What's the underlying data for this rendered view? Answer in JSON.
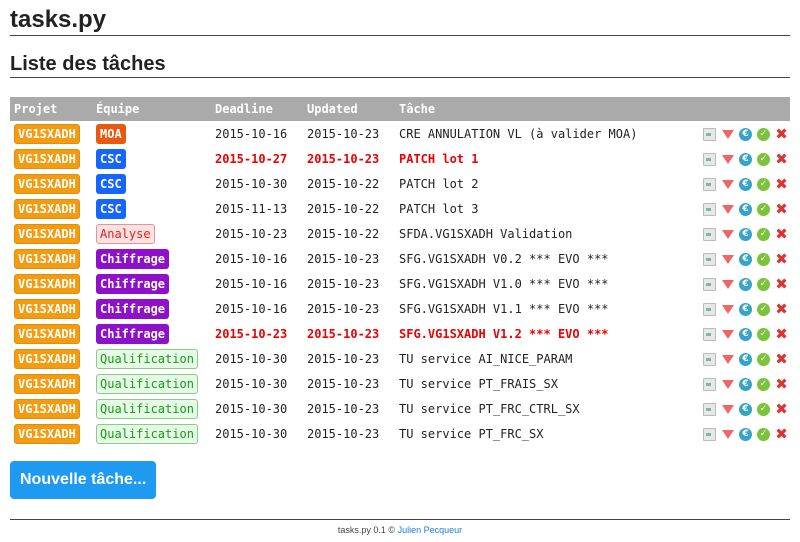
{
  "app_title": "tasks.py",
  "section_title": "Liste des tâches",
  "columns": [
    "Projet",
    "Équipe",
    "Deadline",
    "Updated",
    "Tâche"
  ],
  "rows": [
    {
      "projet": "VG1SXADH",
      "equipe": "MOA",
      "equipe_type": "moa",
      "deadline": "2015-10-16",
      "updated": "2015-10-23",
      "tache": "CRE ANNULATION VL (à valider MOA)",
      "late": false
    },
    {
      "projet": "VG1SXADH",
      "equipe": "CSC",
      "equipe_type": "csc",
      "deadline": "2015-10-27",
      "updated": "2015-10-23",
      "tache": "PATCH lot 1",
      "late": true
    },
    {
      "projet": "VG1SXADH",
      "equipe": "CSC",
      "equipe_type": "csc",
      "deadline": "2015-10-30",
      "updated": "2015-10-22",
      "tache": "PATCH lot 2",
      "late": false
    },
    {
      "projet": "VG1SXADH",
      "equipe": "CSC",
      "equipe_type": "csc",
      "deadline": "2015-11-13",
      "updated": "2015-10-22",
      "tache": "PATCH lot 3",
      "late": false
    },
    {
      "projet": "VG1SXADH",
      "equipe": "Analyse",
      "equipe_type": "ana",
      "deadline": "2015-10-23",
      "updated": "2015-10-22",
      "tache": "SFDA.VG1SXADH Validation",
      "late": false
    },
    {
      "projet": "VG1SXADH",
      "equipe": "Chiffrage",
      "equipe_type": "chi",
      "deadline": "2015-10-16",
      "updated": "2015-10-23",
      "tache": "SFG.VG1SXADH V0.2 *** EVO ***",
      "late": false
    },
    {
      "projet": "VG1SXADH",
      "equipe": "Chiffrage",
      "equipe_type": "chi",
      "deadline": "2015-10-16",
      "updated": "2015-10-23",
      "tache": "SFG.VG1SXADH V1.0 *** EVO ***",
      "late": false
    },
    {
      "projet": "VG1SXADH",
      "equipe": "Chiffrage",
      "equipe_type": "chi",
      "deadline": "2015-10-16",
      "updated": "2015-10-23",
      "tache": "SFG.VG1SXADH V1.1 *** EVO ***",
      "late": false
    },
    {
      "projet": "VG1SXADH",
      "equipe": "Chiffrage",
      "equipe_type": "chi",
      "deadline": "2015-10-23",
      "updated": "2015-10-23",
      "tache": "SFG.VG1SXADH V1.2 *** EVO ***",
      "late": true
    },
    {
      "projet": "VG1SXADH",
      "equipe": "Qualification",
      "equipe_type": "qua",
      "deadline": "2015-10-30",
      "updated": "2015-10-23",
      "tache": "TU service AI_NICE_PARAM",
      "late": false
    },
    {
      "projet": "VG1SXADH",
      "equipe": "Qualification",
      "equipe_type": "qua",
      "deadline": "2015-10-30",
      "updated": "2015-10-23",
      "tache": "TU service PT_FRAIS_SX",
      "late": false
    },
    {
      "projet": "VG1SXADH",
      "equipe": "Qualification",
      "equipe_type": "qua",
      "deadline": "2015-10-30",
      "updated": "2015-10-23",
      "tache": "TU service PT_FRC_CTRL_SX",
      "late": false
    },
    {
      "projet": "VG1SXADH",
      "equipe": "Qualification",
      "equipe_type": "qua",
      "deadline": "2015-10-30",
      "updated": "2015-10-23",
      "tache": "TU service PT_FRC_SX",
      "late": false
    }
  ],
  "row_actions": [
    "document-icon",
    "down-arrow-icon",
    "euro-icon",
    "check-icon",
    "delete-icon"
  ],
  "new_task_button": "Nouvelle tâche...",
  "footer": {
    "text": "tasks.py 0.1 ©",
    "author": "Julien Pecqueur"
  },
  "colors": {
    "late": "#e00000",
    "header_bg": "#aaaaaa",
    "button": "#1e9bf0",
    "projet_badge": "#f39c12"
  }
}
